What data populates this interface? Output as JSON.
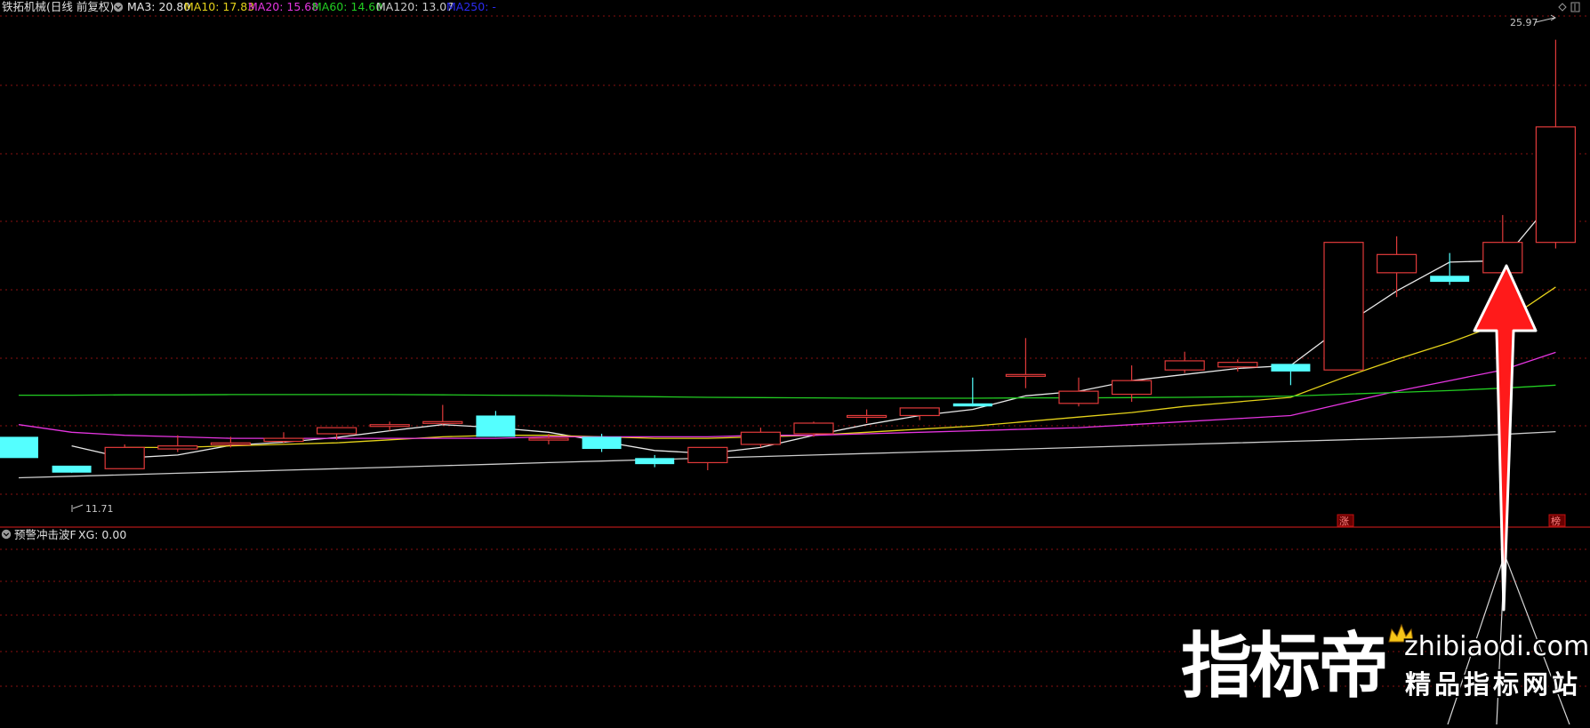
{
  "header": {
    "stock_title": "铁拓机械(日线 前复权)",
    "ma_readouts": [
      {
        "label": "MA3: 20.80",
        "color": "#E8E8E8"
      },
      {
        "label": "MA10: 17.83",
        "color": "#E5D21A"
      },
      {
        "label": "MA20: 15.68",
        "color": "#E535E0"
      },
      {
        "label": "MA60: 14.60",
        "color": "#22CC22"
      },
      {
        "label": "MA120: 13.07",
        "color": "#CCCCCC"
      },
      {
        "label": "MA250: -",
        "color": "#2B2BF0"
      }
    ]
  },
  "price_labels": {
    "high": "25.97",
    "low": "11.71"
  },
  "markers": {
    "limit_up_1": "涨",
    "limit_up_2": "榜"
  },
  "indicator_panel": {
    "title": "预警冲击波F",
    "readout": "XG: 0.00"
  },
  "watermark": {
    "brand": "指标帝",
    "domain": "zhibiaodi.com",
    "slogan": "精品指标网站"
  },
  "colors": {
    "up": "#E03A3A",
    "down": "#54FFFF",
    "grid": "#8A1010",
    "arrow": "#FF1A1A"
  },
  "chart_data": {
    "type": "candlestick",
    "ylim": [
      10.6,
      26.4
    ],
    "candles": [
      {
        "o": 12.9,
        "h": 12.9,
        "l": 12.2,
        "c": 12.2
      },
      {
        "o": 11.95,
        "h": 11.95,
        "l": 11.71,
        "c": 11.72
      },
      {
        "o": 11.85,
        "h": 12.65,
        "l": 11.85,
        "c": 12.55
      },
      {
        "o": 12.5,
        "h": 12.95,
        "l": 12.4,
        "c": 12.6
      },
      {
        "o": 12.65,
        "h": 12.9,
        "l": 12.55,
        "c": 12.7
      },
      {
        "o": 12.75,
        "h": 13.05,
        "l": 12.7,
        "c": 12.85
      },
      {
        "o": 13.0,
        "h": 13.15,
        "l": 12.8,
        "c": 13.2
      },
      {
        "o": 13.25,
        "h": 13.4,
        "l": 13.1,
        "c": 13.3
      },
      {
        "o": 13.35,
        "h": 13.95,
        "l": 13.3,
        "c": 13.4
      },
      {
        "o": 13.6,
        "h": 13.75,
        "l": 12.95,
        "c": 12.9
      },
      {
        "o": 12.85,
        "h": 13.0,
        "l": 12.65,
        "c": 12.85
      },
      {
        "o": 12.9,
        "h": 13.0,
        "l": 12.4,
        "c": 12.5
      },
      {
        "o": 12.2,
        "h": 12.3,
        "l": 11.9,
        "c": 12.0
      },
      {
        "o": 12.05,
        "h": 12.55,
        "l": 11.8,
        "c": 12.55
      },
      {
        "o": 12.65,
        "h": 13.2,
        "l": 12.55,
        "c": 13.05
      },
      {
        "o": 13.0,
        "h": 13.4,
        "l": 12.9,
        "c": 13.35
      },
      {
        "o": 13.6,
        "h": 13.8,
        "l": 13.35,
        "c": 13.6
      },
      {
        "o": 13.6,
        "h": 13.75,
        "l": 13.45,
        "c": 13.85
      },
      {
        "o": 14.0,
        "h": 14.85,
        "l": 14.0,
        "c": 13.9
      },
      {
        "o": 14.95,
        "h": 16.15,
        "l": 14.5,
        "c": 14.95
      },
      {
        "o": 14.0,
        "h": 14.85,
        "l": 13.9,
        "c": 14.4
      },
      {
        "o": 14.3,
        "h": 15.25,
        "l": 14.05,
        "c": 14.75
      },
      {
        "o": 15.1,
        "h": 15.7,
        "l": 15.0,
        "c": 15.4
      },
      {
        "o": 15.2,
        "h": 15.45,
        "l": 15.05,
        "c": 15.35
      },
      {
        "o": 15.3,
        "h": 15.3,
        "l": 14.6,
        "c": 15.05
      },
      {
        "o": 15.1,
        "h": 19.3,
        "l": 15.1,
        "c": 19.3
      },
      {
        "o": 18.3,
        "h": 19.5,
        "l": 17.5,
        "c": 18.9
      },
      {
        "o": 18.2,
        "h": 18.95,
        "l": 17.9,
        "c": 18.0
      },
      {
        "o": 18.3,
        "h": 20.2,
        "l": 18.3,
        "c": 19.3
      },
      {
        "o": 19.3,
        "h": 25.97,
        "l": 19.1,
        "c": 23.1
      }
    ],
    "ma_lines": [
      {
        "name": "MA3",
        "color": "#E8E8E8",
        "values": [
          null,
          12.6,
          12.2,
          12.3,
          12.62,
          12.72,
          12.88,
          13.1,
          13.3,
          13.2,
          13.05,
          12.75,
          12.45,
          12.35,
          12.55,
          12.95,
          13.3,
          13.6,
          13.8,
          14.25,
          14.4,
          14.75,
          14.95,
          15.15,
          15.25,
          16.55,
          17.7,
          18.65,
          18.7,
          20.8
        ]
      },
      {
        "name": "MA10",
        "color": "#E5D21A",
        "values": [
          null,
          null,
          12.55,
          12.55,
          12.6,
          12.65,
          12.7,
          12.8,
          12.9,
          12.95,
          12.95,
          12.9,
          12.85,
          12.85,
          12.9,
          12.95,
          13.05,
          13.15,
          13.25,
          13.4,
          13.55,
          13.7,
          13.9,
          14.05,
          14.2,
          14.85,
          15.45,
          16.0,
          16.65,
          17.83
        ]
      },
      {
        "name": "MA20",
        "color": "#E535E0",
        "values": [
          13.3,
          13.05,
          12.95,
          12.9,
          12.85,
          12.85,
          12.85,
          12.85,
          12.85,
          12.85,
          12.9,
          12.9,
          12.9,
          12.9,
          12.95,
          12.95,
          13.0,
          13.05,
          13.1,
          13.15,
          13.2,
          13.3,
          13.4,
          13.5,
          13.6,
          14.0,
          14.4,
          14.75,
          15.1,
          15.68
        ]
      },
      {
        "name": "MA60",
        "color": "#22CC22",
        "values": [
          14.27,
          14.27,
          14.28,
          14.28,
          14.29,
          14.29,
          14.29,
          14.29,
          14.28,
          14.27,
          14.26,
          14.24,
          14.22,
          14.2,
          14.19,
          14.18,
          14.17,
          14.17,
          14.17,
          14.18,
          14.18,
          14.19,
          14.2,
          14.22,
          14.24,
          14.3,
          14.36,
          14.42,
          14.5,
          14.6
        ]
      },
      {
        "name": "MA120",
        "color": "#CCCCCC",
        "values": [
          11.55,
          11.6,
          11.65,
          11.7,
          11.75,
          11.8,
          11.85,
          11.9,
          11.95,
          12.0,
          12.05,
          12.1,
          12.15,
          12.2,
          12.25,
          12.3,
          12.35,
          12.4,
          12.45,
          12.5,
          12.55,
          12.6,
          12.65,
          12.7,
          12.75,
          12.8,
          12.85,
          12.9,
          12.98,
          13.07
        ]
      }
    ]
  }
}
